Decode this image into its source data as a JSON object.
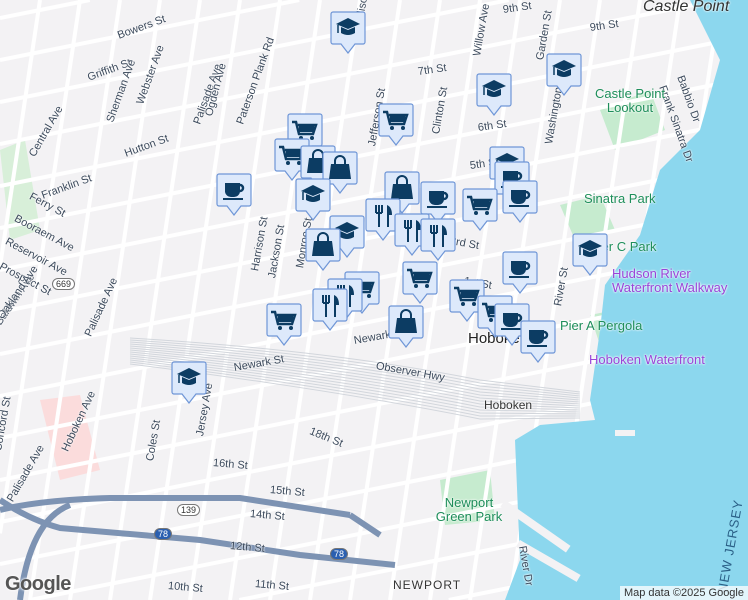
{
  "map": {
    "colors": {
      "water": "#8cd7ee",
      "land": "#f3f2f4",
      "park": "#c6ebcf",
      "road": "#ffffff",
      "highway": "#7d93b3",
      "marker_fill": "#dde9fb",
      "marker_border": "#6f96d7",
      "marker_icon": "#0c3c63"
    },
    "streets": [
      "9th St",
      "9th St",
      "Bowers St",
      "7th St",
      "6th St",
      "5th St",
      "Griffith St",
      "Hutton St",
      "Franklin St",
      "Ferry St",
      "Booraem Ave",
      "Reservoir Ave",
      "Prospect St",
      "Baldwin Ave",
      "Oakland Ave",
      "Central Ave",
      "Sherman Ave",
      "Webster Ave",
      "Palisade Ave",
      "Ogden Ave",
      "Paterson Plank Rd",
      "Madison St",
      "Jefferson St",
      "Clinton St",
      "Willow Ave",
      "Garden St",
      "Washington St",
      "Frank Sinatra Dr",
      "Babbio Dr",
      "Harrison St",
      "Jackson St",
      "Monroe St",
      "Newark St",
      "Newark St",
      "Observer Hwy",
      "3rd St",
      "1st St",
      "River St",
      "River Dr",
      "18th St",
      "16th St",
      "15th St",
      "14th St",
      "12th St",
      "11th St",
      "10th St",
      "Coles St",
      "Jersey Ave",
      "Hoboken Ave",
      "Palisade Ave",
      "Concord St",
      "Palisade Ave"
    ],
    "route_shields": [
      "669",
      "139",
      "78",
      "78"
    ],
    "places": {
      "castle_point": "Castle Point",
      "castle_point_lookout": "Castle Point Lookout",
      "sinatra_park": "Sinatra Park",
      "pier_c_park": "Pier C Park",
      "hudson_walkway": "Hudson River Waterfront Walkway",
      "pier_a": "Pier A Pergola",
      "hoboken_waterfront": "Hoboken Waterfront",
      "hoboken_city": "Hoboken",
      "hoboken_station": "Hoboken",
      "newport_green": "Newport Green Park",
      "newport": "NEWPORT",
      "new_jersey": "NEW JERSEY"
    },
    "markers": [
      "school",
      "school",
      "school",
      "cafe",
      "grocery",
      "grocery",
      "shopping",
      "shopping",
      "school",
      "grocery",
      "shopping",
      "restaurant",
      "cafe",
      "school",
      "cafe",
      "grocery",
      "cafe",
      "restaurant",
      "restaurant",
      "school",
      "shopping",
      "school",
      "cafe",
      "grocery",
      "grocery",
      "restaurant",
      "restaurant",
      "grocery",
      "grocery",
      "grocery",
      "shopping",
      "cafe",
      "cafe",
      "school"
    ],
    "logo": "Google",
    "attribution": "Map data ©2025 Google"
  }
}
